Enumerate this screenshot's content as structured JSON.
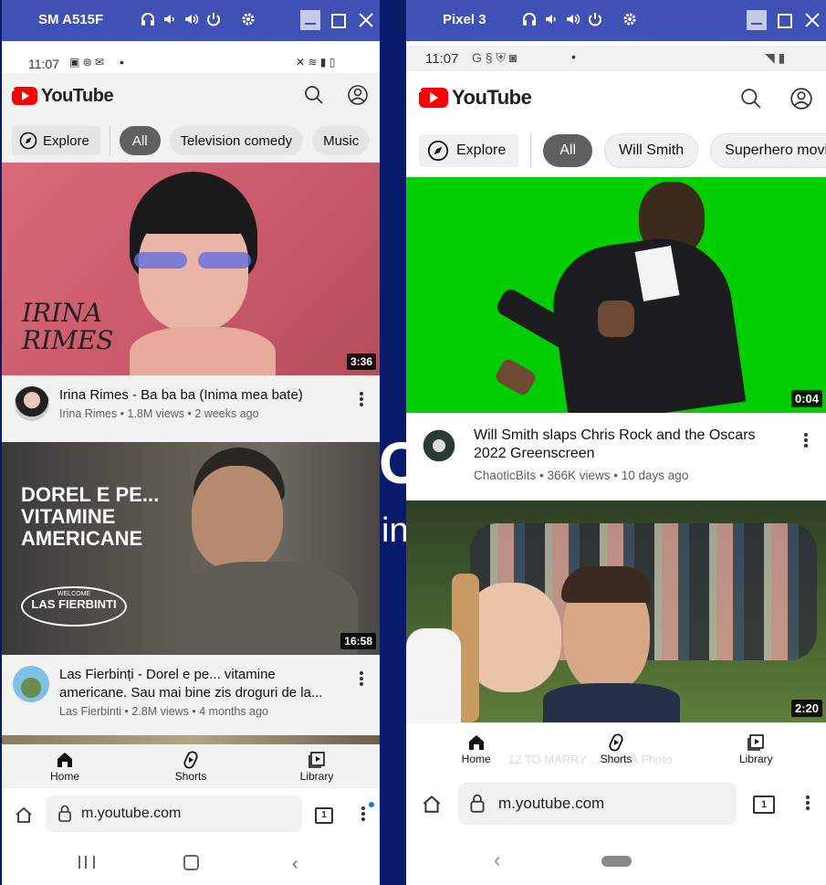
{
  "background": {
    "glyph_o": "O",
    "glyph_in": "in"
  },
  "left": {
    "window_title": "SM A515F",
    "status": {
      "time": "11:07",
      "dot": "•"
    },
    "search_icon": "search-icon",
    "chips": {
      "explore": "Explore",
      "all": "All",
      "c1": "Television comedy",
      "c2": "Music"
    },
    "videos": [
      {
        "title": "Irina Rimes - Ba ba ba (Inima mea bate)",
        "sub": "Irina Rimes • 1.8M views • 2 weeks ago",
        "duration": "3:36",
        "art_line1": "IRINA",
        "art_line2": "RIMES"
      },
      {
        "title": "Las Fierbinți - Dorel e pe... vitamine americane. Sau mai bine zis droguri de la...",
        "sub": "Las Fierbinti • 2.8M views • 4 months ago",
        "duration": "16:58",
        "art_line1": "DOREL E PE...",
        "art_line2": "VITAMINE",
        "art_line3": "AMERICANE",
        "art_logo": "LAS FIERBINTI",
        "art_logo_top": "WELCOME"
      }
    ],
    "nav": {
      "home": "Home",
      "shorts": "Shorts",
      "library": "Library"
    },
    "url": "m.youtube.com",
    "tabs_count": "1"
  },
  "right": {
    "window_title": "Pixel 3",
    "status": {
      "time": "11:07",
      "dot": "•"
    },
    "chips": {
      "explore": "Explore",
      "all": "All",
      "c1": "Will Smith",
      "c2": "Superhero movies"
    },
    "videos": [
      {
        "title": "Will Smith slaps Chris Rock and the Oscars 2022 Greenscreen",
        "sub": "ChaoticBits • 366K views • 10 days ago",
        "duration": "0:04"
      },
      {
        "duration": "2:20",
        "peek_title": "12 TO MARRY ... Took A Photo"
      }
    ],
    "nav": {
      "home": "Home",
      "shorts": "Shorts",
      "library": "Library"
    },
    "url": "m.youtube.com",
    "tabs_count": "1"
  },
  "logo_text": "YouTube",
  "colors": {
    "titlebar": "#3f51b5",
    "yt_red": "#ff0000",
    "greenscreen": "#00ce00",
    "desktop": "#0a1a6b"
  }
}
